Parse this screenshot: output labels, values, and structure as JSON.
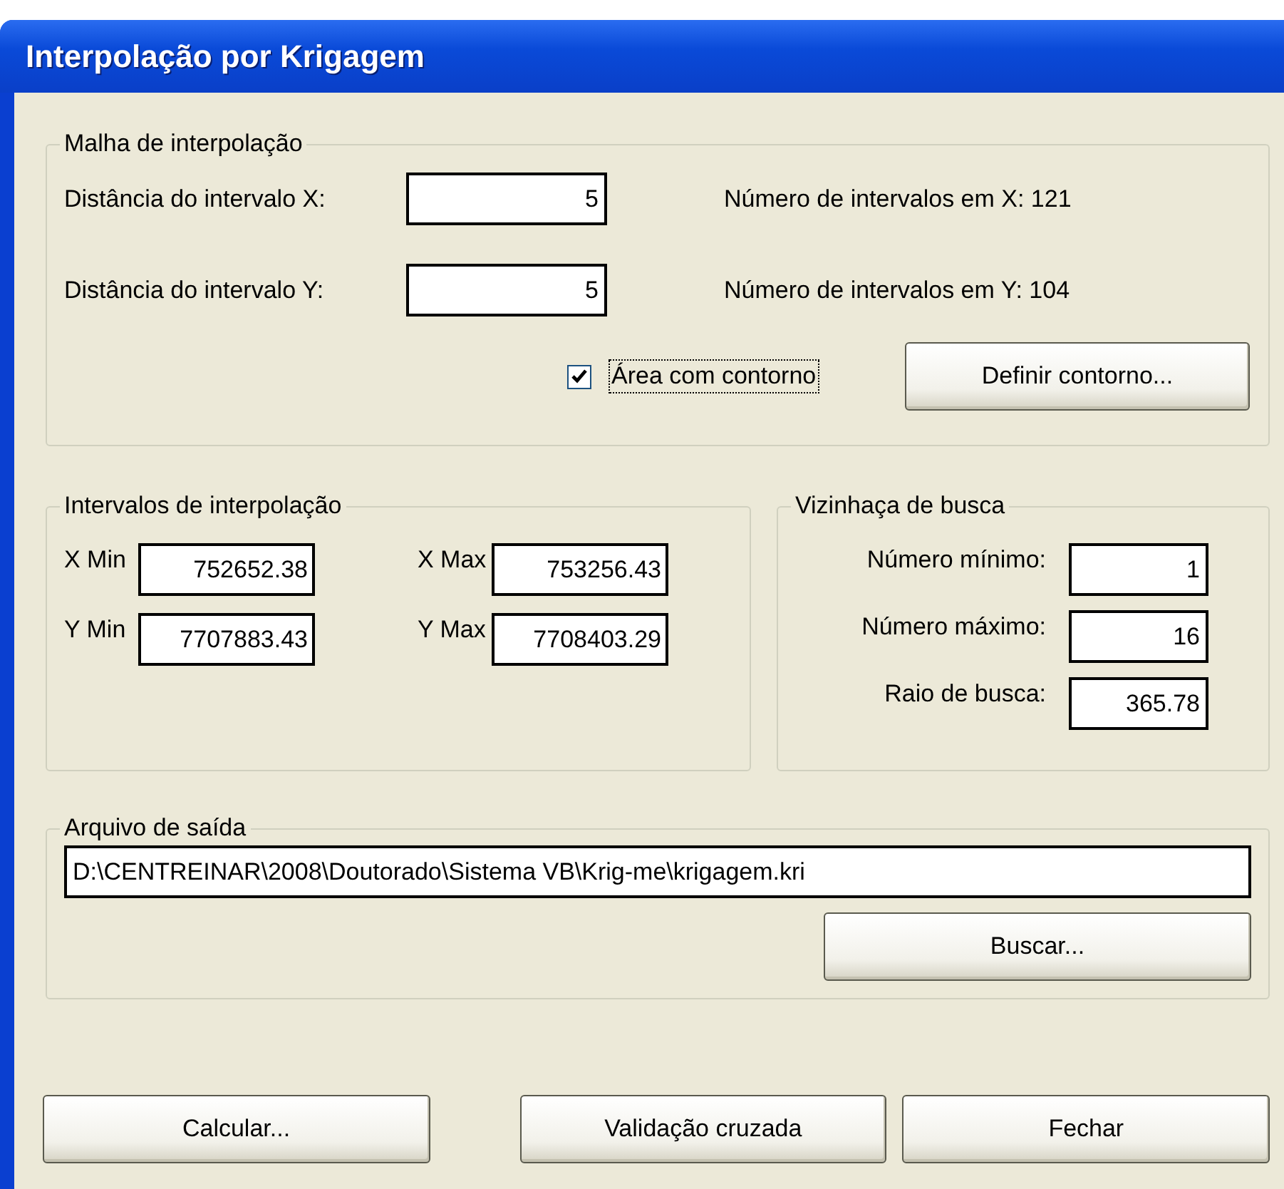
{
  "window": {
    "title": "Interpolação por Krigagem"
  },
  "grid": {
    "legend": "Malha de interpolação",
    "rows": [
      {
        "label": "Distância do intervalo X:",
        "value": "5",
        "count": "Número de intervalos em X: 121"
      },
      {
        "label": "Distância do intervalo Y:",
        "value": "5",
        "count": "Número de intervalos em Y: 104"
      }
    ],
    "contour": {
      "label": "Área com contorno",
      "checked": true
    },
    "define_button": "Definir contorno..."
  },
  "intervals": {
    "legend": "Intervalos de interpolação",
    "fields": [
      {
        "label": "X Min",
        "value": "752652.38"
      },
      {
        "label": "X Max",
        "value": "753256.43"
      },
      {
        "label": "Y Min",
        "value": "7707883.43"
      },
      {
        "label": "Y Max",
        "value": "7708403.29"
      }
    ]
  },
  "neighborhood": {
    "legend": "Vizinhaça de busca",
    "fields": [
      {
        "label": "Número mínimo:",
        "value": "1"
      },
      {
        "label": "Número máximo:",
        "value": "16"
      },
      {
        "label": "Raio de busca:",
        "value": "365.78"
      }
    ]
  },
  "output": {
    "legend": "Arquivo de saída",
    "path": "D:\\CENTREINAR\\2008\\Doutorado\\Sistema VB\\Krig-me\\krigagem.kri",
    "browse_button": "Buscar..."
  },
  "buttons": [
    "Calcular...",
    "Validação cruzada",
    "Fechar"
  ]
}
